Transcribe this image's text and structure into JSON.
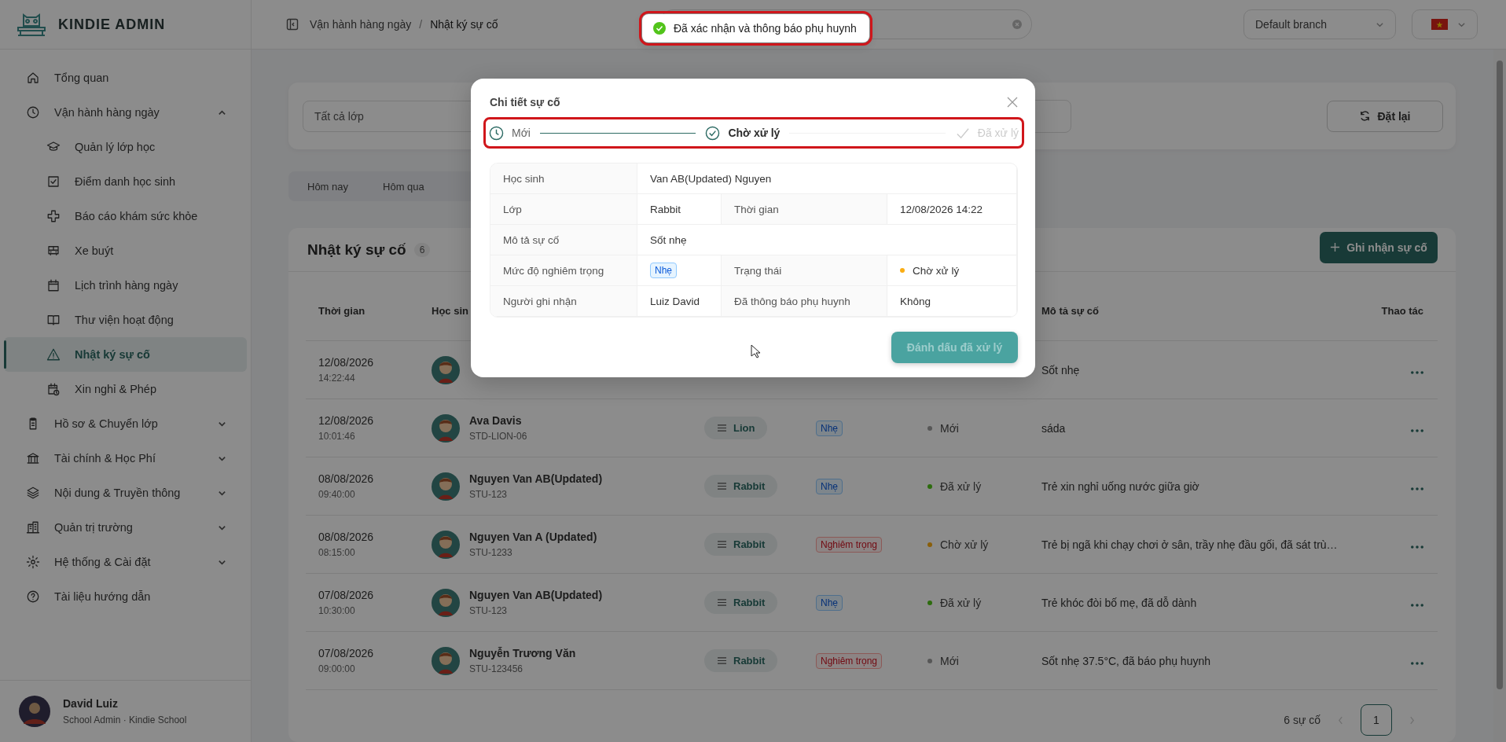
{
  "sidebar": {
    "logo": "KINDIE ADMIN",
    "items": [
      {
        "label": "Tổng quan",
        "selected": false
      },
      {
        "label": "Vận hành hàng ngày",
        "selected": false,
        "expanded": true,
        "children": [
          {
            "label": "Quản lý lớp học",
            "selected": false
          },
          {
            "label": "Điểm danh học sinh",
            "selected": false
          },
          {
            "label": "Báo cáo khám sức khỏe",
            "selected": false
          },
          {
            "label": "Xe buýt",
            "selected": false
          },
          {
            "label": "Lịch trình hàng ngày",
            "selected": false
          },
          {
            "label": "Thư viện hoạt động",
            "selected": false
          },
          {
            "label": "Nhật ký sự cố",
            "selected": true
          },
          {
            "label": "Xin nghỉ & Phép",
            "selected": false
          }
        ]
      },
      {
        "label": "Hồ sơ & Chuyển lớp",
        "selected": false,
        "expanded": false
      },
      {
        "label": "Tài chính & Học Phí",
        "selected": false,
        "expanded": false
      },
      {
        "label": "Nội dung & Truyền thông",
        "selected": false,
        "expanded": false
      },
      {
        "label": "Quản trị trường",
        "selected": false,
        "expanded": false
      },
      {
        "label": "Hệ thống & Cài đặt",
        "selected": false,
        "expanded": false
      },
      {
        "label": "Tài liệu hướng dẫn",
        "selected": false
      }
    ],
    "user": {
      "name": "David Luiz",
      "role": "School Admin · Kindie School"
    }
  },
  "header": {
    "breadcrumb": [
      "Vận hành hàng ngày",
      "Nhật ký sự cố"
    ],
    "breadcrumb_separator": "/",
    "branch_select": "Default branch"
  },
  "toast": {
    "message": "Đã xác nhận và thông báo phụ huynh",
    "highlighted": true
  },
  "filters": {
    "class_select": "Tất cả lớp",
    "reset_button": "Đặt lại",
    "date_tabs": [
      {
        "label": "Hôm nay",
        "selected": false
      },
      {
        "label": "Hôm qua",
        "selected": false
      }
    ]
  },
  "incidents": {
    "title": "Nhật ký sự cố",
    "count": "6",
    "add_button": "Ghi nhận sự cố",
    "columns": {
      "time": "Thời gian",
      "student": "Học sin",
      "description": "Mô tả sự cố",
      "actions": "Thao tác"
    },
    "rows": [
      {
        "date": "12/08/2026",
        "time": "14:22:44",
        "description": "Sốt nhẹ"
      },
      {
        "date": "12/08/2026",
        "time": "10:01:46",
        "name": "Ava Davis",
        "student_id": "STD-LION-06",
        "class": "Lion",
        "severity": {
          "label": "Nhẹ",
          "kind": "mild"
        },
        "status": {
          "label": "Mới",
          "color": "#575757"
        },
        "description": "sáda"
      },
      {
        "date": "08/08/2026",
        "time": "09:40:00",
        "name": "Nguyen Van AB(Updated)",
        "student_id": "STU-123",
        "class": "Rabbit",
        "severity": {
          "label": "Nhẹ",
          "kind": "mild"
        },
        "status": {
          "label": "Đã xử lý",
          "color": "#2d6c0e"
        },
        "description": "Trẻ xin nghỉ uống nước giữa giờ"
      },
      {
        "date": "08/08/2026",
        "time": "08:15:00",
        "name": "Nguyen Van A (Updated)",
        "student_id": "STU-1233",
        "class": "Rabbit",
        "severity": {
          "label": "Nghiêm trọng",
          "kind": "severe"
        },
        "status": {
          "label": "Chờ xử lý",
          "color": "#8a5f0b"
        },
        "description": "Trẻ bị ngã khi chạy chơi ở sân, trầy nhẹ đầu gối, đã sát trù…"
      },
      {
        "date": "07/08/2026",
        "time": "10:30:00",
        "name": "Nguyen Van AB(Updated)",
        "student_id": "STU-123",
        "class": "Rabbit",
        "severity": {
          "label": "Nhẹ",
          "kind": "mild"
        },
        "status": {
          "label": "Đã xử lý",
          "color": "#2d6c0e"
        },
        "description": "Trẻ khóc đòi bố mẹ, đã dỗ dành"
      },
      {
        "date": "07/08/2026",
        "time": "09:00:00",
        "name": "Nguyễn Trương Văn",
        "student_id": "STU-123456",
        "class": "Rabbit",
        "severity": {
          "label": "Nghiêm trọng",
          "kind": "severe"
        },
        "status": {
          "label": "Mới",
          "color": "#575757"
        },
        "description": "Sốt nhẹ 37.5°C, đã báo phụ huynh"
      }
    ],
    "pagination": {
      "summary": "6 sự cố",
      "pages": [
        {
          "label": "1",
          "selected": true
        }
      ]
    }
  },
  "modal": {
    "title": "Chi tiết sự cố",
    "steps_highlighted": true,
    "steps": [
      {
        "label": "Mới",
        "done": true,
        "active": false
      },
      {
        "label": "Chờ xử lý",
        "done": false,
        "active": true
      },
      {
        "label": "Đã xử lý",
        "done": false,
        "active": false
      }
    ],
    "details": [
      [
        {
          "kind": "label",
          "text": "Học sinh"
        },
        {
          "kind": "text",
          "text": "Van AB(Updated) Nguyen"
        }
      ],
      [
        {
          "kind": "label",
          "text": "Lớp"
        },
        {
          "kind": "text",
          "text": "Rabbit"
        },
        {
          "kind": "label",
          "text": "Thời gian"
        },
        {
          "kind": "text",
          "text": "12/08/2026 14:22"
        }
      ],
      [
        {
          "kind": "label",
          "text": "Mô tả sự cố"
        },
        {
          "kind": "text",
          "text": "Sốt nhẹ"
        }
      ],
      [
        {
          "kind": "label",
          "text": "Mức độ nghiêm trọng"
        },
        {
          "kind": "tag",
          "text": "Nhẹ"
        },
        {
          "kind": "label",
          "text": "Trạng thái"
        },
        {
          "kind": "status",
          "text": "Chờ xử lý",
          "color": "#faad14"
        }
      ],
      [
        {
          "kind": "label",
          "text": "Người ghi nhận"
        },
        {
          "kind": "text",
          "text": "Luiz David"
        },
        {
          "kind": "label",
          "text": "Đã thông báo phụ huynh"
        },
        {
          "kind": "text",
          "text": "Không"
        }
      ]
    ],
    "confirm_button": "Đánh dấu đã xử lý"
  }
}
